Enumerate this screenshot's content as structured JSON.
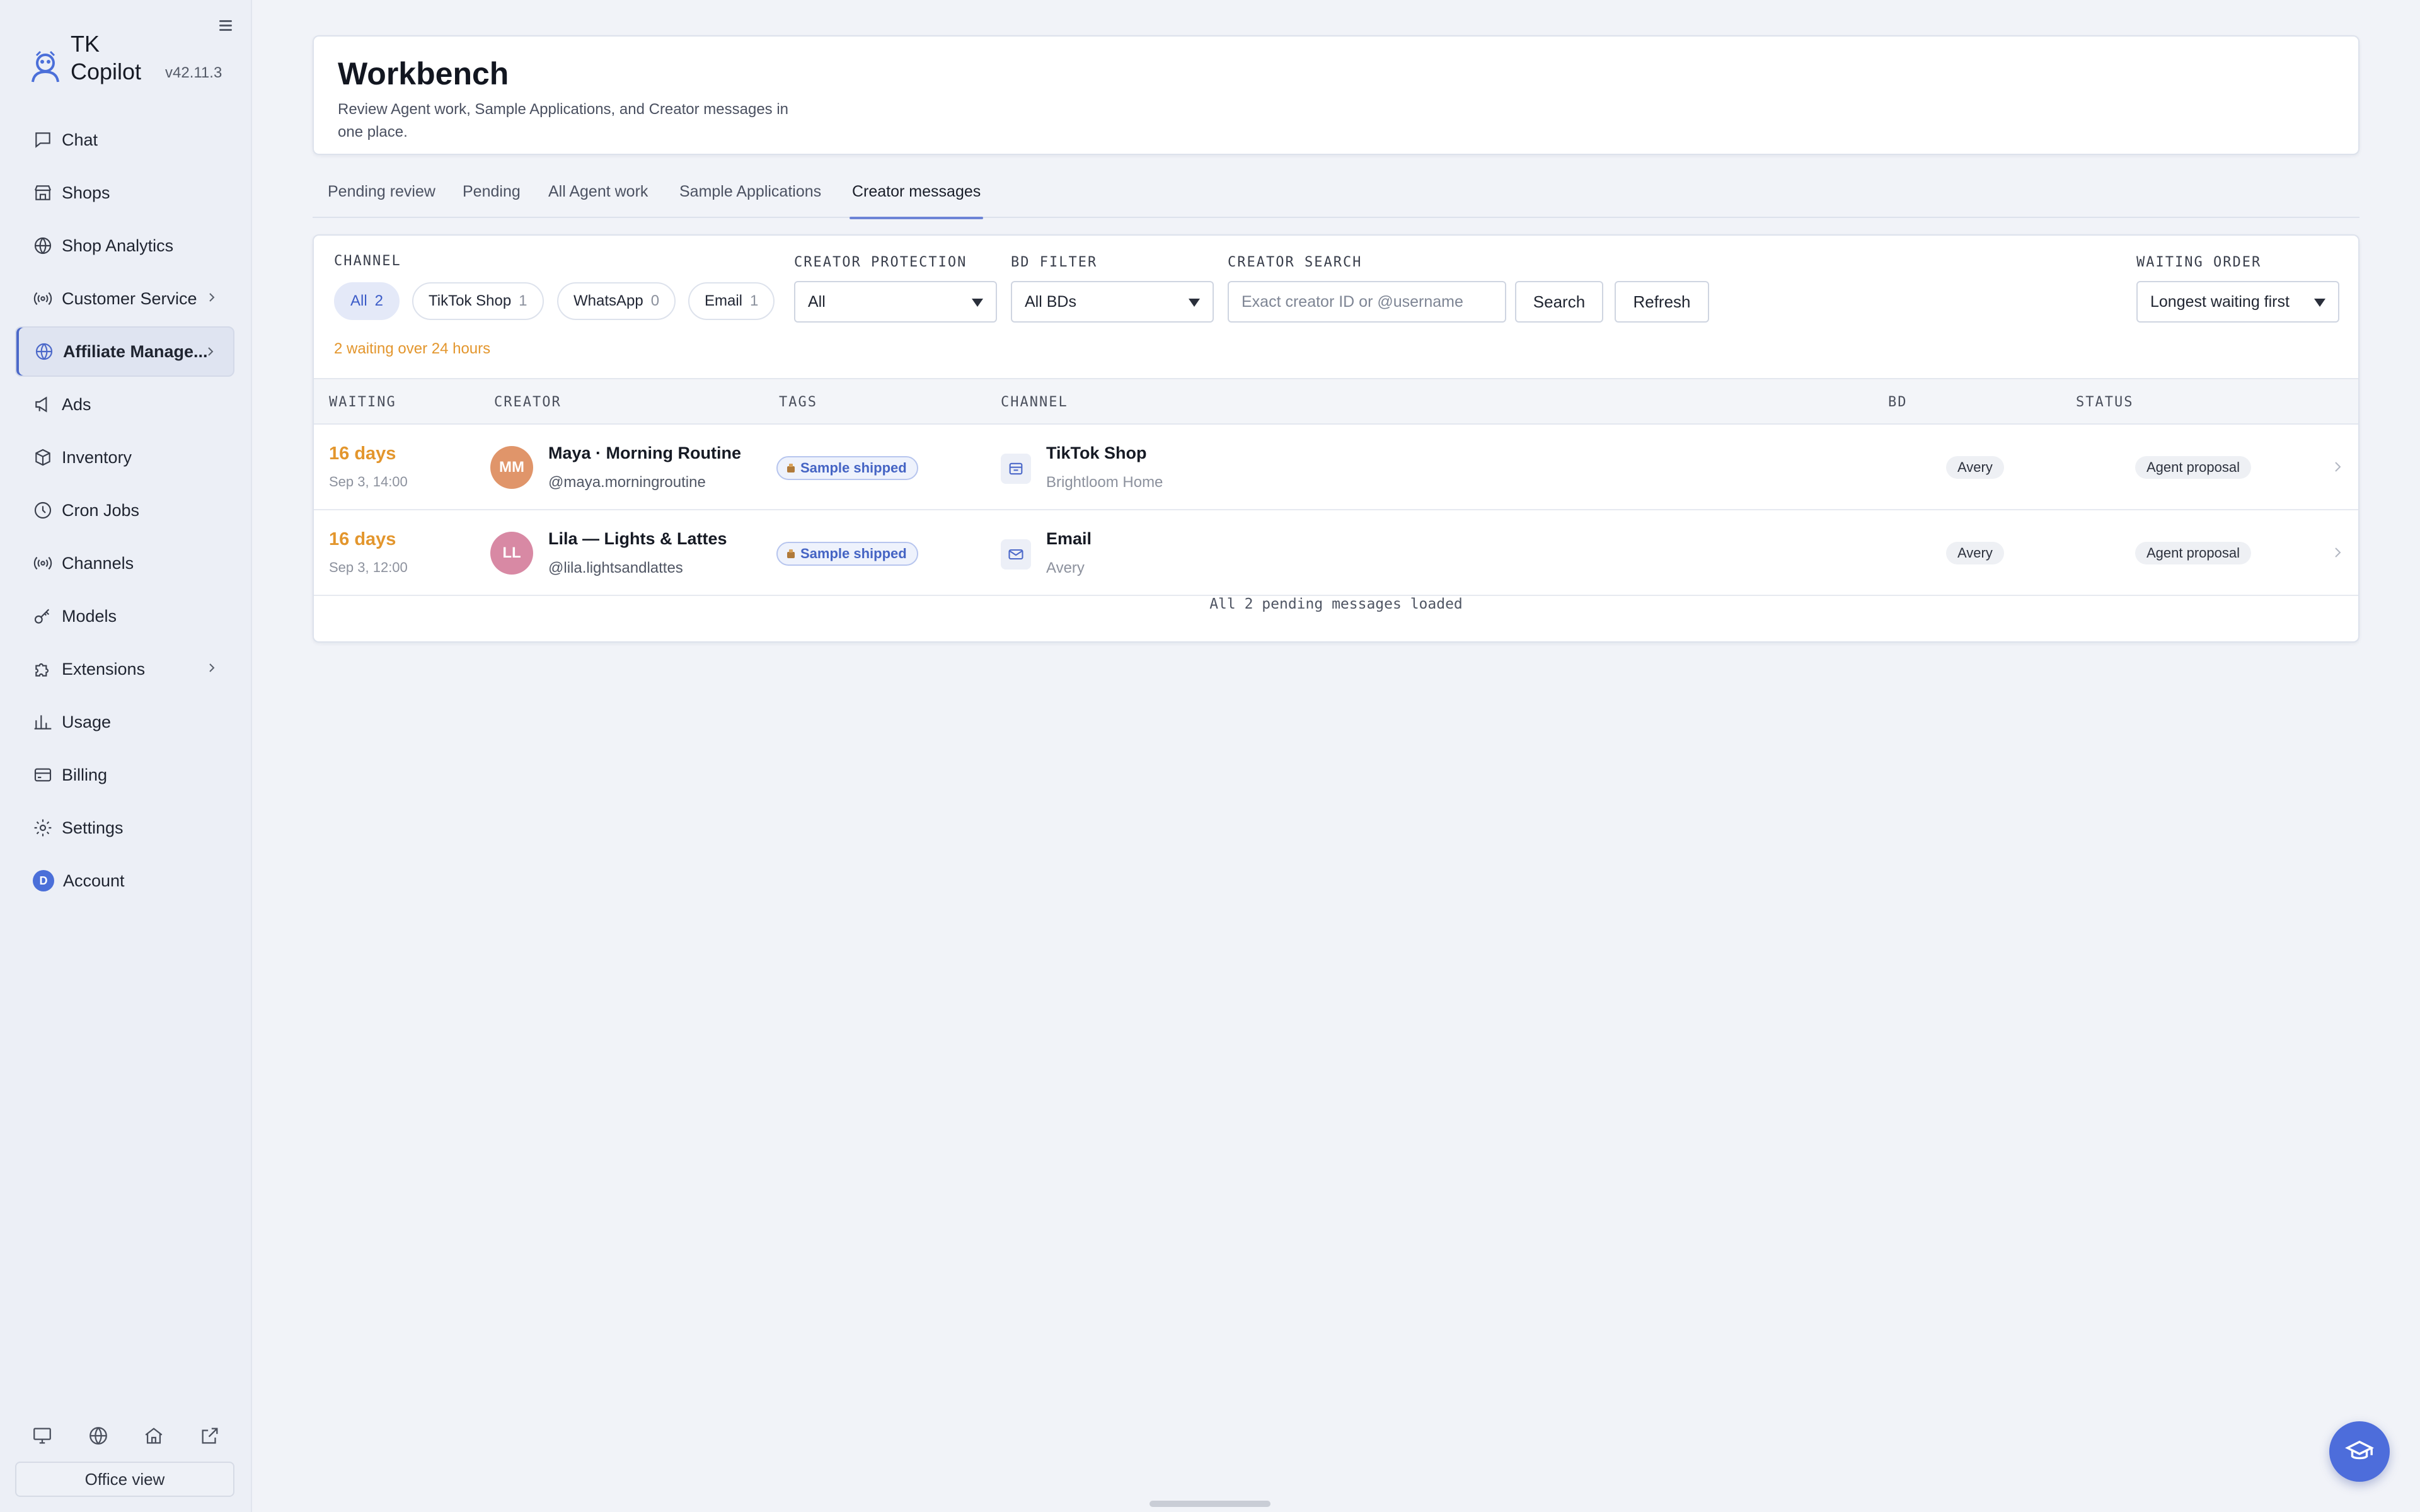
{
  "app": {
    "name_line1": "TK",
    "name_line2": "Copilot",
    "version": "v42.11.3"
  },
  "sidebar": {
    "items": [
      {
        "label": "Chat",
        "icon": "chat-icon"
      },
      {
        "label": "Shops",
        "icon": "store-icon"
      },
      {
        "label": "Shop Analytics",
        "icon": "globe-icon"
      },
      {
        "label": "Customer Service",
        "icon": "broadcast-icon"
      },
      {
        "label": "Affiliate Manage...",
        "icon": "globe-icon"
      },
      {
        "label": "Ads",
        "icon": "megaphone-icon"
      },
      {
        "label": "Inventory",
        "icon": "box-icon"
      },
      {
        "label": "Cron Jobs",
        "icon": "clock-icon"
      },
      {
        "label": "Channels",
        "icon": "broadcast-icon"
      },
      {
        "label": "Models",
        "icon": "key-icon"
      },
      {
        "label": "Extensions",
        "icon": "puzzle-icon"
      },
      {
        "label": "Usage",
        "icon": "bar-chart-icon"
      },
      {
        "label": "Billing",
        "icon": "card-icon"
      },
      {
        "label": "Settings",
        "icon": "gear-icon"
      },
      {
        "label": "Account",
        "icon": "avatar",
        "initial": "D"
      }
    ],
    "active": "Affiliate Manage...",
    "office_view_label": "Office view"
  },
  "header": {
    "title": "Workbench",
    "subtitle": "Review Agent work, Sample Applications, and Creator messages in one place."
  },
  "tabs": [
    {
      "label": "Pending review"
    },
    {
      "label": "Pending"
    },
    {
      "label": "All Agent work"
    },
    {
      "label": "Sample Applications"
    },
    {
      "label": "Creator messages"
    }
  ],
  "active_tab": "Creator messages",
  "filters": {
    "channel_label": "CHANNEL",
    "channels": [
      {
        "label": "All",
        "count": "2"
      },
      {
        "label": "TikTok Shop",
        "count": "1"
      },
      {
        "label": "WhatsApp",
        "count": "0"
      },
      {
        "label": "Email",
        "count": "1"
      }
    ],
    "creator_protection_label": "CREATOR PROTECTION",
    "creator_protection_value": "All",
    "bd_filter_label": "BD FILTER",
    "bd_filter_value": "All BDs",
    "creator_search_label": "CREATOR SEARCH",
    "creator_search_placeholder": "Exact creator ID or @username",
    "search_button": "Search",
    "refresh_button": "Refresh",
    "waiting_order_label": "WAITING ORDER",
    "waiting_order_value": "Longest waiting first",
    "waiting_warning": "2 waiting over 24 hours"
  },
  "table": {
    "columns": [
      "WAITING",
      "CREATOR",
      "TAGS",
      "CHANNEL",
      "BD",
      "STATUS"
    ],
    "rows": [
      {
        "waiting": "16 days",
        "date": "Sep 3, 14:00",
        "initials": "MM",
        "name": "Maya · Morning Routine",
        "handle": "@maya.morningroutine",
        "tag": "Sample shipped",
        "channel": "TikTok Shop",
        "channel_sub": "Brightloom Home",
        "channel_icon": "shop-icon",
        "bd": "Avery",
        "status": "Agent proposal"
      },
      {
        "waiting": "16 days",
        "date": "Sep 3, 12:00",
        "initials": "LL",
        "name": "Lila — Lights & Lattes",
        "handle": "@lila.lightsandlattes",
        "tag": "Sample shipped",
        "channel": "Email",
        "channel_sub": "Avery",
        "channel_icon": "mail-icon",
        "bd": "Avery",
        "status": "Agent proposal"
      }
    ],
    "footer": "All 2 pending messages loaded"
  },
  "colors": {
    "accent": "#4b68c9",
    "warning": "#e3962d",
    "avatar_mm": "#e0956a",
    "avatar_ll": "#d889a4"
  }
}
